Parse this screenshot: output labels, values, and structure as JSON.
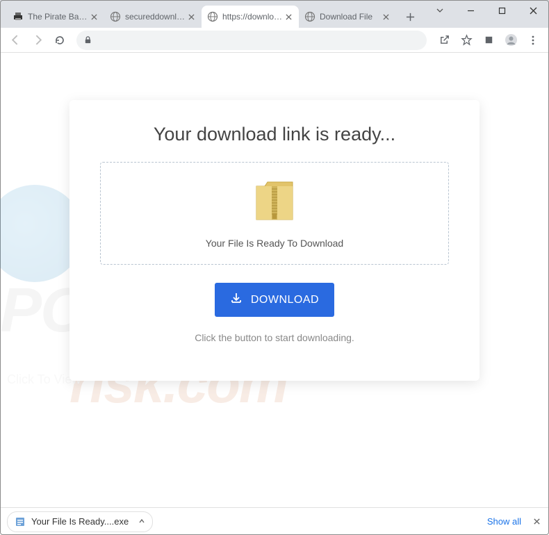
{
  "window_controls": {
    "dropdown": "⌄",
    "minimize": "—",
    "maximize": "▢",
    "close": "✕"
  },
  "tabs": [
    {
      "title": "The Pirate Bay - Th",
      "favicon": "pirate"
    },
    {
      "title": "secureddownload",
      "favicon": "globe"
    },
    {
      "title": "https://downloadi",
      "favicon": "globe",
      "active": true
    },
    {
      "title": "Download File",
      "favicon": "globe"
    }
  ],
  "new_tab_label": "+",
  "toolbar": {
    "share_icon": "share",
    "star_icon": "star",
    "ext_icon": "ext",
    "profile_icon": "profile",
    "menu_icon": "menu"
  },
  "page": {
    "heading": "Your download link is ready...",
    "file_ready": "Your File Is Ready To Download",
    "download_button": "DOWNLOAD",
    "hint": "Click the button to start downloading."
  },
  "watermark": {
    "click_to_view": "Click To View",
    "line1": "PC",
    "line2": "risk.com"
  },
  "download_bar": {
    "item_name": "Your File Is Ready....exe",
    "show_all": "Show all"
  }
}
